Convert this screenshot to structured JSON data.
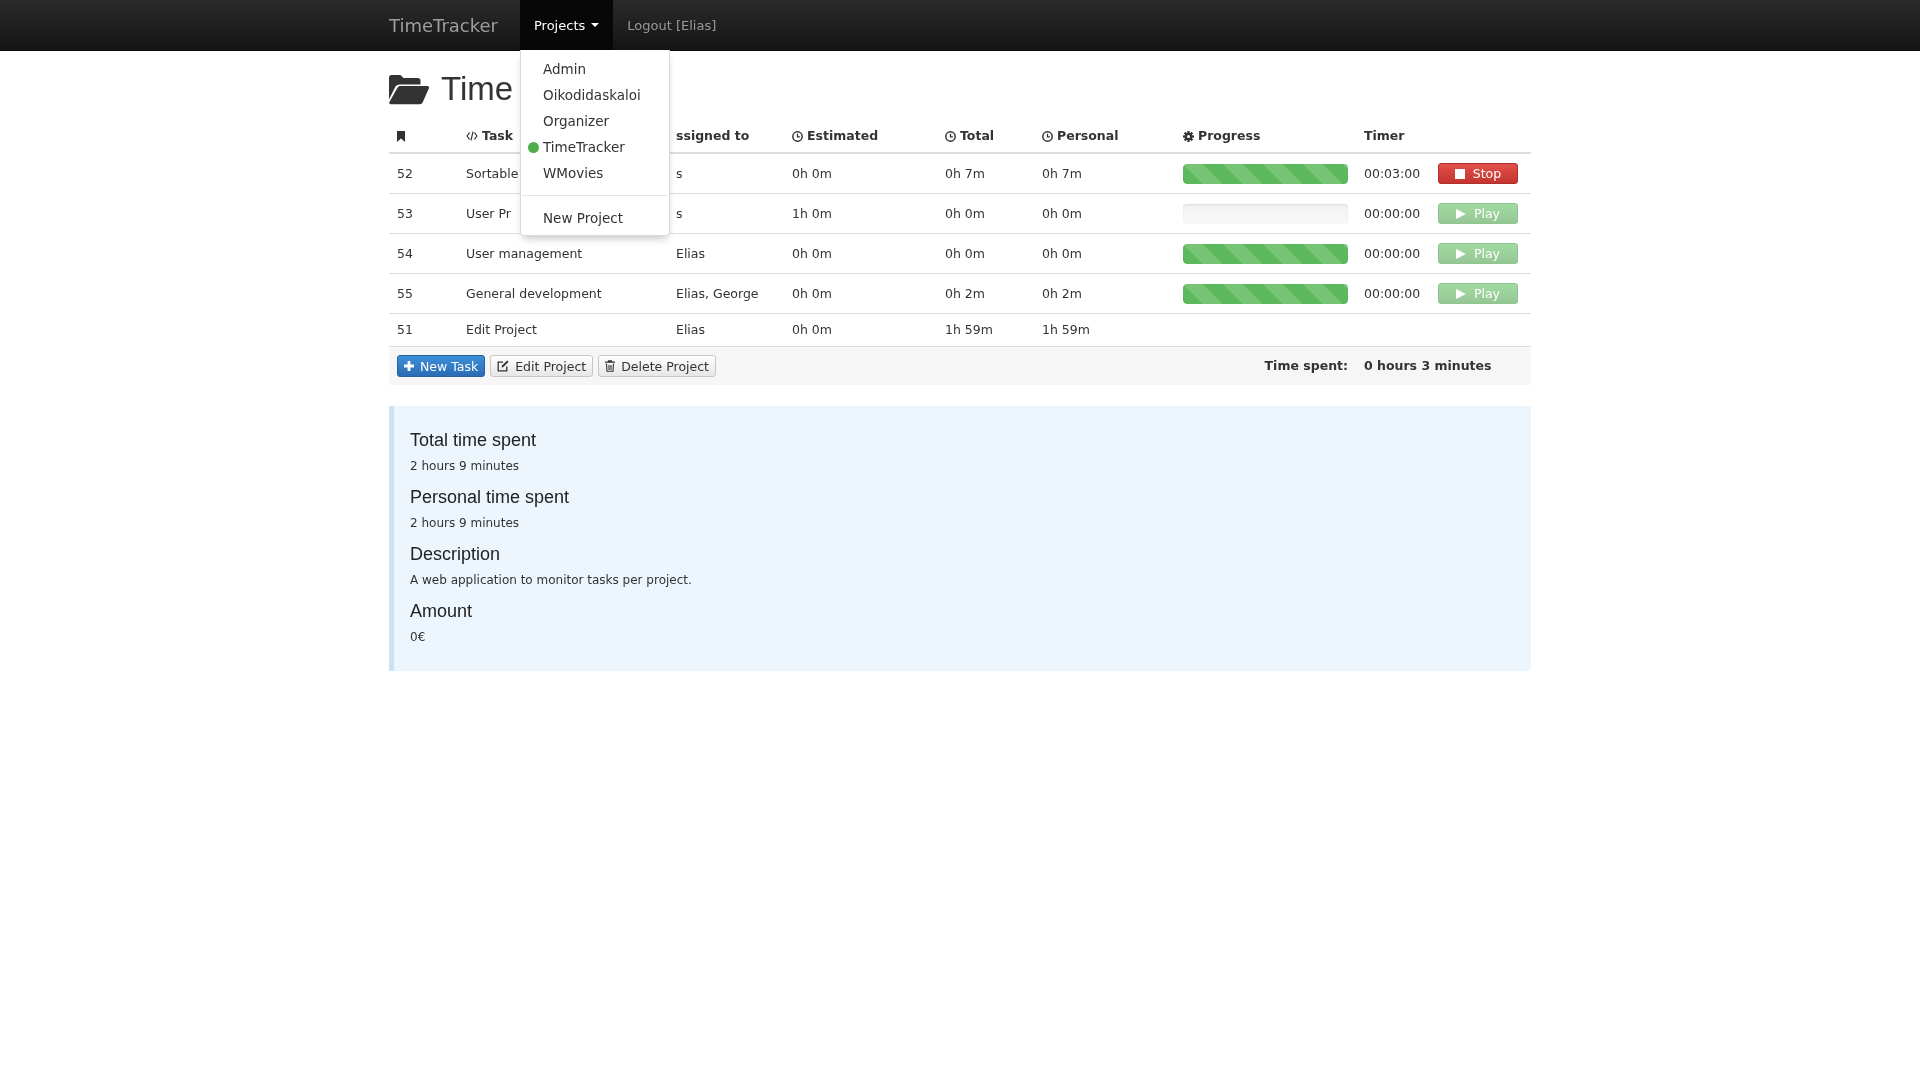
{
  "navbar": {
    "brand": "TimeTracker",
    "projects_menu": {
      "label": "Projects",
      "expanded": true,
      "items": [
        {
          "label": "Admin",
          "selected": false
        },
        {
          "label": "Oikodidaskaloi",
          "selected": false
        },
        {
          "label": "Organizer",
          "selected": false
        },
        {
          "label": "TimeTracker",
          "selected": true
        },
        {
          "label": "WMovies",
          "selected": false
        }
      ],
      "new_project": "New Project"
    },
    "logout": "Logout [Elias]"
  },
  "page_header": {
    "title": "Time"
  },
  "table": {
    "columns": [
      {
        "kind": "id"
      },
      {
        "kind": "task",
        "label": "Task"
      },
      {
        "kind": "assignee",
        "label": "ssigned to"
      },
      {
        "kind": "duration",
        "label": "Estimated"
      },
      {
        "kind": "duration",
        "label": "Total"
      },
      {
        "kind": "duration",
        "label": "Personal"
      },
      {
        "kind": "progress",
        "label": "Progress"
      },
      {
        "kind": "timer",
        "label": "Timer"
      }
    ],
    "rows": [
      {
        "id": "52",
        "task": "Sortable",
        "assigned_to": "s",
        "estimated": "0h 0m",
        "total": "0h 7m",
        "personal": "0h 7m",
        "progress": {
          "level": 1
        },
        "timer": "00:03:00",
        "timer_button": {
          "kind": "stop",
          "label": "Stop",
          "disabled": false
        }
      },
      {
        "id": "53",
        "task": "User Pr",
        "assigned_to": "s",
        "estimated": "1h 0m",
        "total": "0h 0m",
        "personal": "0h 0m",
        "progress": {
          "level": 0
        },
        "timer": "00:00:00",
        "timer_button": {
          "kind": "play",
          "label": "Play",
          "disabled": true
        }
      },
      {
        "id": "54",
        "task": "User management",
        "assigned_to": "Elias",
        "estimated": "0h 0m",
        "total": "0h 0m",
        "personal": "0h 0m",
        "progress": {
          "level": 1
        },
        "timer": "00:00:00",
        "timer_button": {
          "kind": "play",
          "label": "Play",
          "disabled": true
        }
      },
      {
        "id": "55",
        "task": "General development",
        "assigned_to": "Elias, George",
        "estimated": "0h 0m",
        "total": "0h 2m",
        "personal": "0h 2m",
        "progress": {
          "level": 1
        },
        "timer": "00:00:00",
        "timer_button": {
          "kind": "play",
          "label": "Play",
          "disabled": true
        }
      },
      {
        "id": "51",
        "task": "Edit Project",
        "assigned_to": "Elias",
        "estimated": "0h 0m",
        "total": "1h 59m",
        "personal": "1h 59m"
      }
    ],
    "footer": {
      "buttons": [
        {
          "kind": "add",
          "label": "New Task"
        },
        {
          "kind": "edit",
          "label": "Edit Project"
        },
        {
          "kind": "delete",
          "label": "Delete Project"
        }
      ],
      "time_spent_label": "Time spent:",
      "time_spent_value": "0 hours 3 minutes"
    }
  },
  "details": [
    {
      "heading": "Total time spent",
      "value": "2 hours 9 minutes"
    },
    {
      "heading": "Personal time spent",
      "value": "2 hours 9 minutes"
    },
    {
      "heading": "Description",
      "value": "A web application to monitor tasks per project."
    },
    {
      "heading": "Amount",
      "value": "0€"
    }
  ]
}
